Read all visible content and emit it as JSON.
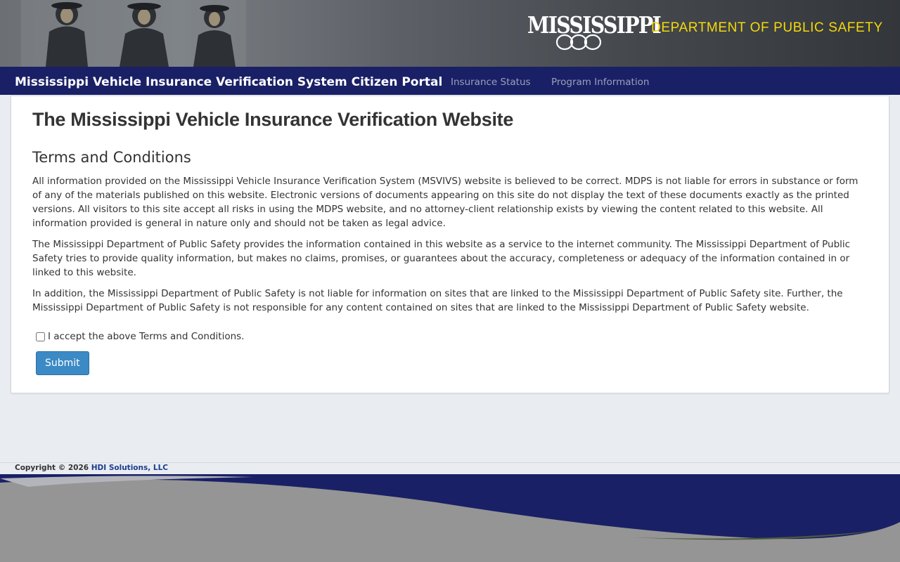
{
  "header": {
    "logo_state": "MISSISSIPPI",
    "logo_department": "DEPARTMENT OF PUBLIC SAFETY"
  },
  "navbar": {
    "brand": "Mississippi Vehicle Insurance Verification System Citizen Portal",
    "links": [
      {
        "label": "Insurance Status"
      },
      {
        "label": "Program Information"
      }
    ]
  },
  "main": {
    "title": "The Mississippi Vehicle Insurance Verification Website",
    "section_title": "Terms and Conditions",
    "paragraphs": [
      "All information provided on the Mississippi Vehicle Insurance Verification System (MSVIVS) website is believed to be correct. MDPS is not liable for errors in substance or form of any of the materials published on this website. Electronic versions of documents appearing on this site do not display the text of these documents exactly as the printed versions. All visitors to this site accept all risks in using the MDPS website, and no attorney-client relationship exists by viewing the content related to this website. All information provided is general in nature only and should not be taken as legal advice.",
      "The Mississippi Department of Public Safety provides the information contained in this website as a service to the internet community. The Mississippi Department of Public Safety tries to provide quality information, but makes no claims, promises, or guarantees about the accuracy, completeness or adequacy of the information contained in or linked to this website.",
      "In addition, the Mississippi Department of Public Safety is not liable for information on sites that are linked to the Mississippi Department of Public Safety site. Further, the Mississippi Department of Public Safety is not responsible for any content contained on sites that are linked to the Mississippi Department of Public Safety website."
    ],
    "accept_label": "I accept the above Terms and Conditions.",
    "accept_checked": false,
    "submit_label": "Submit"
  },
  "footer": {
    "copyright_prefix": "Copyright © 2026",
    "company_link": "HDI Solutions, LLC"
  },
  "colors": {
    "navbar": "#1a2066",
    "logo_department": "#f5d90a",
    "button": "#3b8ac5",
    "page_background": "#e9edf2",
    "footer_wave_gray": "#959595"
  }
}
